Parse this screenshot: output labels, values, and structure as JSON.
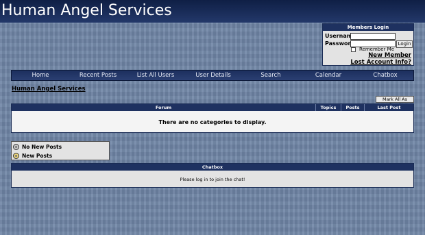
{
  "site": {
    "title": "Human Angel Services"
  },
  "login": {
    "heading": "Members Login",
    "username_label": "Username",
    "password_label": "Password",
    "username_value": "",
    "password_value": "",
    "login_button": "Login",
    "remember_label": "Remember Me",
    "new_member": "New Member",
    "lost_account": "Lost Account Info?"
  },
  "nav": {
    "items": [
      {
        "label": "Home"
      },
      {
        "label": "Recent Posts"
      },
      {
        "label": "List All Users"
      },
      {
        "label": "User Details"
      },
      {
        "label": "Search"
      },
      {
        "label": "Calendar"
      },
      {
        "label": "Chatbox"
      }
    ]
  },
  "breadcrumb": "Human Angel Services",
  "mark_all_read": "Mark All As Read",
  "forum_table": {
    "columns": [
      "Forum",
      "Topics",
      "Posts",
      "Last Post"
    ],
    "empty_message": "There are no categories to display."
  },
  "legend": {
    "items": [
      {
        "label": "No New Posts",
        "icon": "no-new-posts-icon"
      },
      {
        "label": "New Posts",
        "icon": "new-posts-icon"
      }
    ]
  },
  "chatbox": {
    "heading": "Chatbox",
    "message": "Please log in to join the chat!"
  },
  "colors": {
    "header_bar": "#1e3160",
    "background": "#6f85a6",
    "panel": "#e3e3e3"
  }
}
